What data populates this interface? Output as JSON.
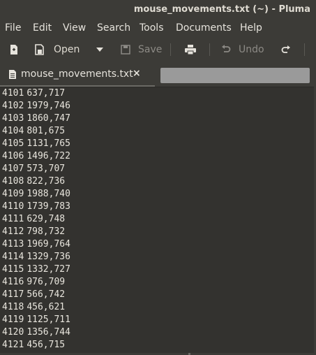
{
  "window": {
    "title": "mouse_movements.txt (~) - Pluma"
  },
  "menubar": {
    "items": [
      {
        "label": "File"
      },
      {
        "label": "Edit"
      },
      {
        "label": "View"
      },
      {
        "label": "Search"
      },
      {
        "label": "Tools"
      },
      {
        "label": "Documents"
      },
      {
        "label": "Help"
      }
    ]
  },
  "toolbar": {
    "new_icon": "new-document-icon",
    "open_label": "Open",
    "open_dropdown_icon": "chevron-down-icon",
    "save_label": "Save",
    "print_icon": "print-icon",
    "undo_label": "Undo",
    "redo_icon": "redo-icon"
  },
  "tabs": [
    {
      "label": "mouse_movements.txt",
      "close": "×",
      "active": true
    }
  ],
  "editor": {
    "lines": [
      {
        "num": "4101",
        "text": "637,717"
      },
      {
        "num": "4102",
        "text": "1979,746"
      },
      {
        "num": "4103",
        "text": "1860,747"
      },
      {
        "num": "4104",
        "text": "801,675"
      },
      {
        "num": "4105",
        "text": "1131,765"
      },
      {
        "num": "4106",
        "text": "1496,722"
      },
      {
        "num": "4107",
        "text": "573,707"
      },
      {
        "num": "4108",
        "text": "822,736"
      },
      {
        "num": "4109",
        "text": "1988,740"
      },
      {
        "num": "4110",
        "text": "1739,783"
      },
      {
        "num": "4111",
        "text": "629,748"
      },
      {
        "num": "4112",
        "text": "798,732"
      },
      {
        "num": "4113",
        "text": "1969,764"
      },
      {
        "num": "4114",
        "text": "1329,736"
      },
      {
        "num": "4115",
        "text": "1332,727"
      },
      {
        "num": "4116",
        "text": "976,709"
      },
      {
        "num": "4117",
        "text": "566,742"
      },
      {
        "num": "4118",
        "text": "456,621"
      },
      {
        "num": "4119",
        "text": "1125,711"
      },
      {
        "num": "4120",
        "text": "1356,744"
      },
      {
        "num": "4121",
        "text": "456,715"
      }
    ]
  },
  "colors": {
    "window_bg": "#3c3b37",
    "editor_bg": "#33322f",
    "text": "#e8e5dd",
    "disabled_text": "#8c8a85"
  }
}
